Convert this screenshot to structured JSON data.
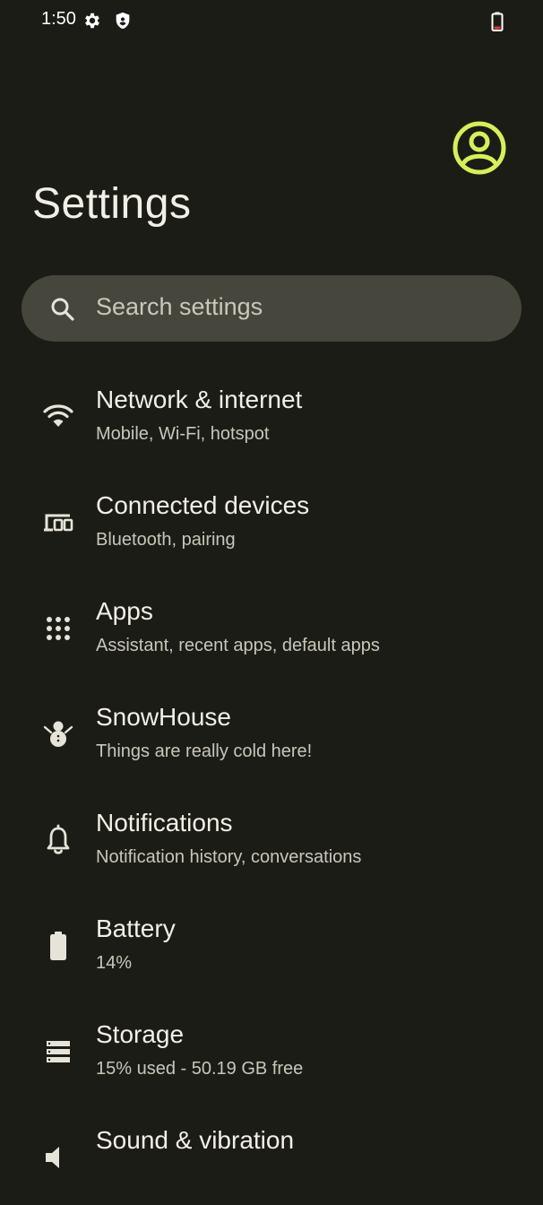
{
  "status_bar": {
    "time": "1:50",
    "icons": [
      "gear-icon",
      "shield-icon",
      "battery-low-icon"
    ],
    "battery_alert_color": "#e53935"
  },
  "header": {
    "title": "Settings",
    "avatar_icon": "account-circle-icon",
    "accent_color": "#d4f05a"
  },
  "search": {
    "placeholder": "Search settings",
    "icon": "search-icon"
  },
  "settings": {
    "items": [
      {
        "icon": "wifi-icon",
        "title": "Network & internet",
        "summary": "Mobile, Wi-Fi, hotspot"
      },
      {
        "icon": "connected-devices-icon",
        "title": "Connected devices",
        "summary": "Bluetooth, pairing"
      },
      {
        "icon": "apps-grid-icon",
        "title": "Apps",
        "summary": "Assistant, recent apps, default apps"
      },
      {
        "icon": "snowman-icon",
        "title": "SnowHouse",
        "summary": "Things are really cold here!"
      },
      {
        "icon": "bell-icon",
        "title": "Notifications",
        "summary": "Notification history, conversations"
      },
      {
        "icon": "battery-icon",
        "title": "Battery",
        "summary": "14%"
      },
      {
        "icon": "storage-icon",
        "title": "Storage",
        "summary": "15% used - 50.19 GB free"
      },
      {
        "icon": "volume-icon",
        "title": "Sound & vibration",
        "summary": ""
      }
    ]
  }
}
